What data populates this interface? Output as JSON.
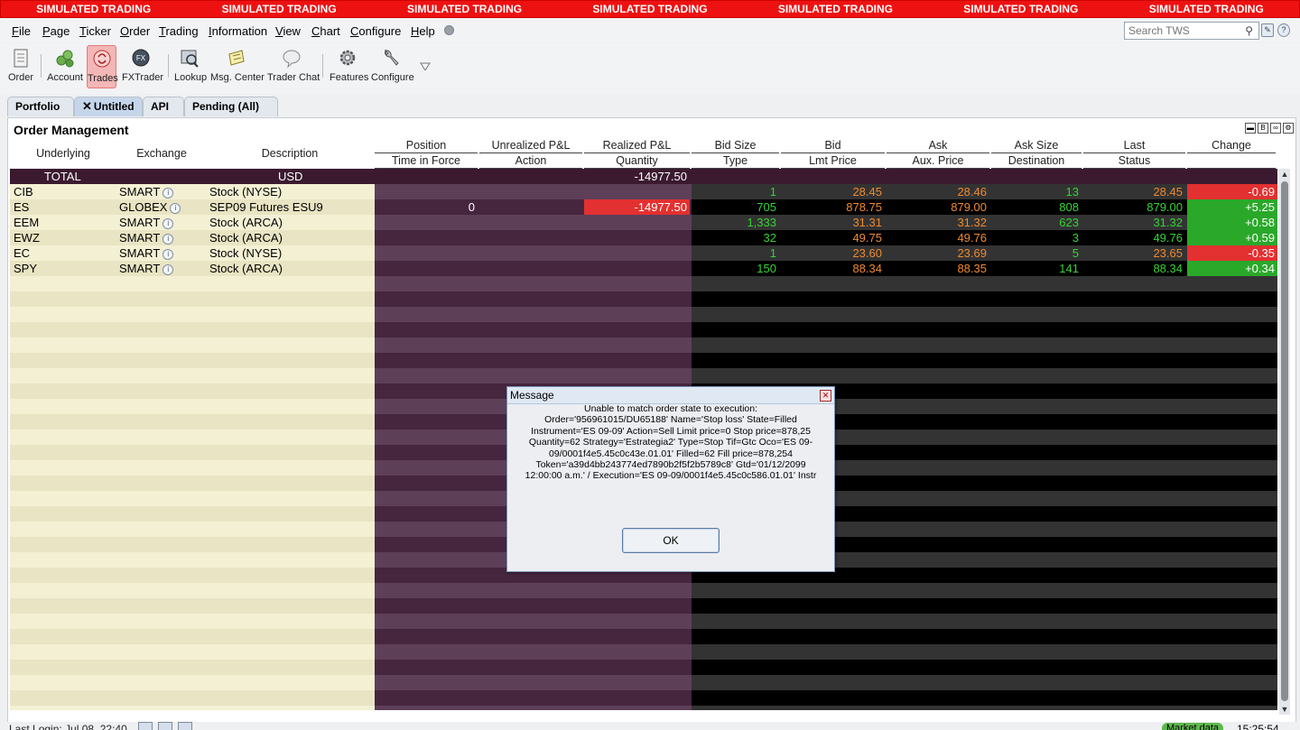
{
  "banner": [
    "SIMULATED TRADING",
    "SIMULATED TRADING",
    "SIMULATED TRADING",
    "SIMULATED TRADING",
    "SIMULATED TRADING",
    "SIMULATED TRADING",
    "SIMULATED TRADING"
  ],
  "menu": [
    "File",
    "Page",
    "Ticker",
    "Order",
    "Trading",
    "Information",
    "View",
    "Chart",
    "Configure",
    "Help"
  ],
  "search": {
    "placeholder": "Search TWS"
  },
  "toolbar": {
    "order": "Order",
    "account": "Account",
    "trades": "Trades",
    "fxtrader": "FXTrader",
    "lookup": "Lookup",
    "msg_center": "Msg. Center",
    "trader_chat": "Trader Chat",
    "features": "Features",
    "configure": "Configure"
  },
  "tabs": {
    "portfolio": "Portfolio",
    "untitled": "Untitled",
    "api": "API",
    "pending": "Pending (All)"
  },
  "panel": {
    "title": "Order Management"
  },
  "headers": {
    "underlying": "Underlying",
    "exchange": "Exchange",
    "description": "Description",
    "position": "Position",
    "time_in_force": "Time in Force",
    "unrealized": "Unrealized P&L",
    "action": "Action",
    "realized": "Realized P&L",
    "quantity": "Quantity",
    "bid_size": "Bid Size",
    "type": "Type",
    "bid": "Bid",
    "lmt_price": "Lmt Price",
    "ask": "Ask",
    "aux_price": "Aux. Price",
    "ask_size": "Ask Size",
    "destination": "Destination",
    "last": "Last",
    "status": "Status",
    "change": "Change"
  },
  "total": {
    "label": "TOTAL",
    "currency": "USD",
    "realized": "-14977.50"
  },
  "rows": [
    {
      "underlying": "CIB",
      "exchange": "SMART",
      "description": "Stock (NYSE)",
      "position": "",
      "realized": "",
      "bid_size": "1",
      "bid": "28.45",
      "ask": "28.46",
      "ask_size": "13",
      "last": "28.45",
      "change": "-0.69",
      "change_dir": "down"
    },
    {
      "underlying": "ES",
      "exchange": "GLOBEX",
      "description": "SEP09 Futures ESU9",
      "position": "0",
      "realized": "-14977.50",
      "bid_size": "705",
      "bid": "878.75",
      "ask": "879.00",
      "ask_size": "808",
      "last": "879.00",
      "change": "+5.25",
      "change_dir": "up"
    },
    {
      "underlying": "EEM",
      "exchange": "SMART",
      "description": "Stock (ARCA)",
      "position": "",
      "realized": "",
      "bid_size": "1,333",
      "bid": "31.31",
      "ask": "31.32",
      "ask_size": "623",
      "last": "31.32",
      "change": "+0.58",
      "change_dir": "up"
    },
    {
      "underlying": "EWZ",
      "exchange": "SMART",
      "description": "Stock (ARCA)",
      "position": "",
      "realized": "",
      "bid_size": "32",
      "bid": "49.75",
      "ask": "49.76",
      "ask_size": "3",
      "last": "49.76",
      "change": "+0.59",
      "change_dir": "up"
    },
    {
      "underlying": "EC",
      "exchange": "SMART",
      "description": "Stock (NYSE)",
      "position": "",
      "realized": "",
      "bid_size": "1",
      "bid": "23.60",
      "ask": "23.69",
      "ask_size": "5",
      "last": "23.65",
      "change": "-0.35",
      "change_dir": "down"
    },
    {
      "underlying": "SPY",
      "exchange": "SMART",
      "description": "Stock (ARCA)",
      "position": "",
      "realized": "",
      "bid_size": "150",
      "bid": "88.34",
      "ask": "88.35",
      "ask_size": "141",
      "last": "88.34",
      "change": "+0.34",
      "change_dir": "up"
    }
  ],
  "colors": {
    "down_red": "#e33030",
    "up_green": "#2aa82a",
    "bid_size_color": "#35d435",
    "price_color": "#f08a2e"
  },
  "dialog": {
    "title": "Message",
    "lines": [
      "Unable to match order state to execution:",
      "Order='956961015/DU65188' Name='Stop loss' State=Filled",
      "Instrument='ES 09-09' Action=Sell Limit price=0 Stop price=878,25",
      "Quantity=62 Strategy='Estrategia2' Type=Stop Tif=Gtc Oco='ES 09-",
      "09/0001f4e5.45c0c43e.01.01' Filled=62 Fill price=878,254",
      "Token='a39d4bb243774ed7890b2f5f2b5789c8' Gtd='01/12/2099",
      "12:00:00 a.m.'   /   Execution='ES  09-09/0001f4e5.45c0c586.01.01' Instr"
    ],
    "ok": "OK"
  },
  "status": {
    "login": "Last Login: Jul 08, 22:40",
    "market_data": "Market data",
    "clock": "15:25:54"
  }
}
